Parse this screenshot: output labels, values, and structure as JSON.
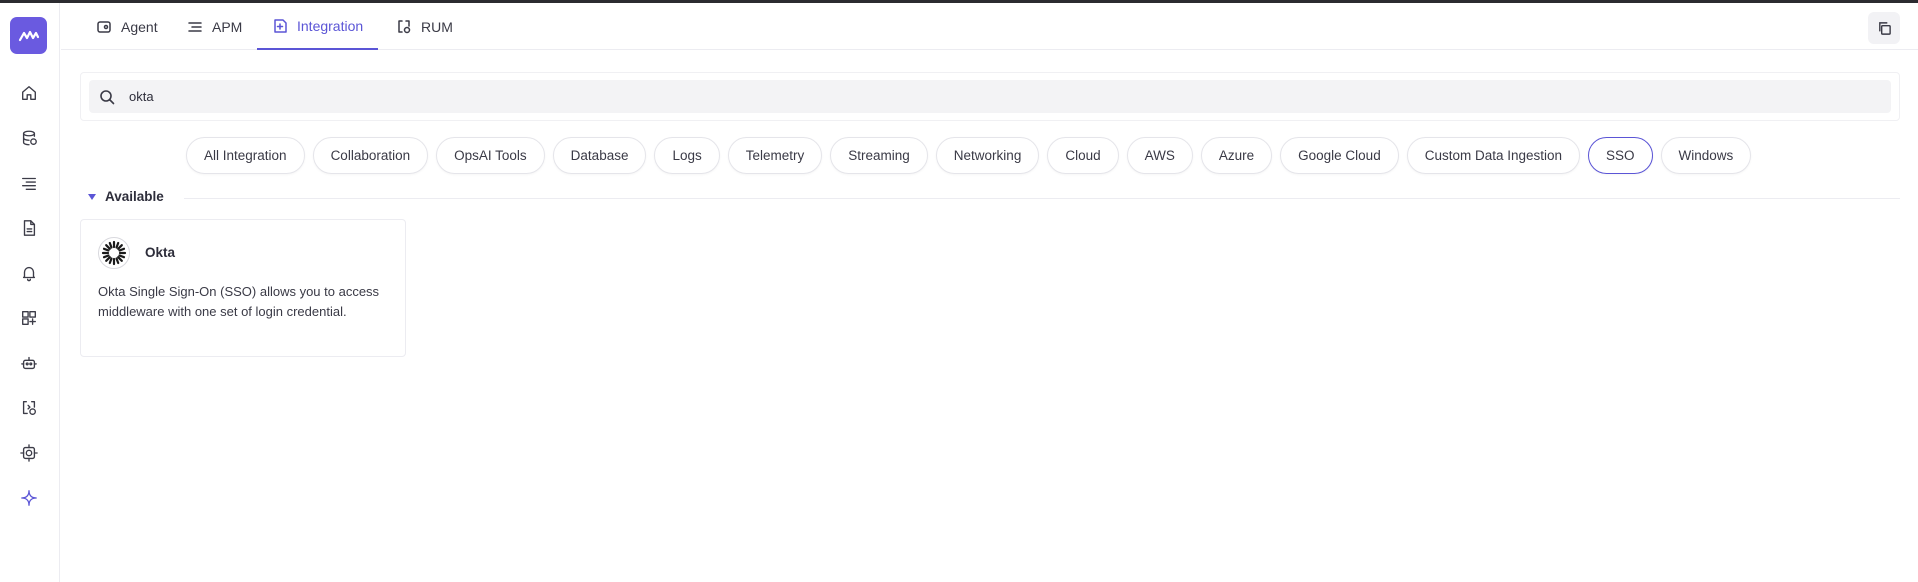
{
  "colors": {
    "accent": "#5b55d6",
    "logo_bg": "#6a5ae0"
  },
  "sidebar": {
    "logo": "logo-icon",
    "items": [
      {
        "icon": "home-icon"
      },
      {
        "icon": "infrastructure-icon"
      },
      {
        "icon": "list-icon"
      },
      {
        "icon": "document-icon"
      },
      {
        "icon": "alert-bell-icon"
      },
      {
        "icon": "dashboard-add-icon"
      },
      {
        "icon": "robot-icon"
      },
      {
        "icon": "rum-icon"
      },
      {
        "icon": "settings-icon"
      },
      {
        "icon": "sparkle-icon"
      }
    ]
  },
  "tabs": [
    {
      "label": "Agent",
      "icon": "agent-icon"
    },
    {
      "label": "APM",
      "icon": "apm-icon"
    },
    {
      "label": "Integration",
      "icon": "integration-icon",
      "active": true
    },
    {
      "label": "RUM",
      "icon": "rum-icon"
    }
  ],
  "search": {
    "value": "okta",
    "icon": "search-icon"
  },
  "filters": [
    "All Integration",
    "Collaboration",
    "OpsAI Tools",
    "Database",
    "Logs",
    "Telemetry",
    "Streaming",
    "Networking",
    "Cloud",
    "AWS",
    "Azure",
    "Google Cloud",
    "Custom Data Ingestion",
    "SSO",
    "Windows"
  ],
  "active_filter": "SSO",
  "section": {
    "label": "Available"
  },
  "card": {
    "title": "Okta",
    "description": "Okta Single Sign-On (SSO) allows you to access middleware with one set of login credential."
  }
}
